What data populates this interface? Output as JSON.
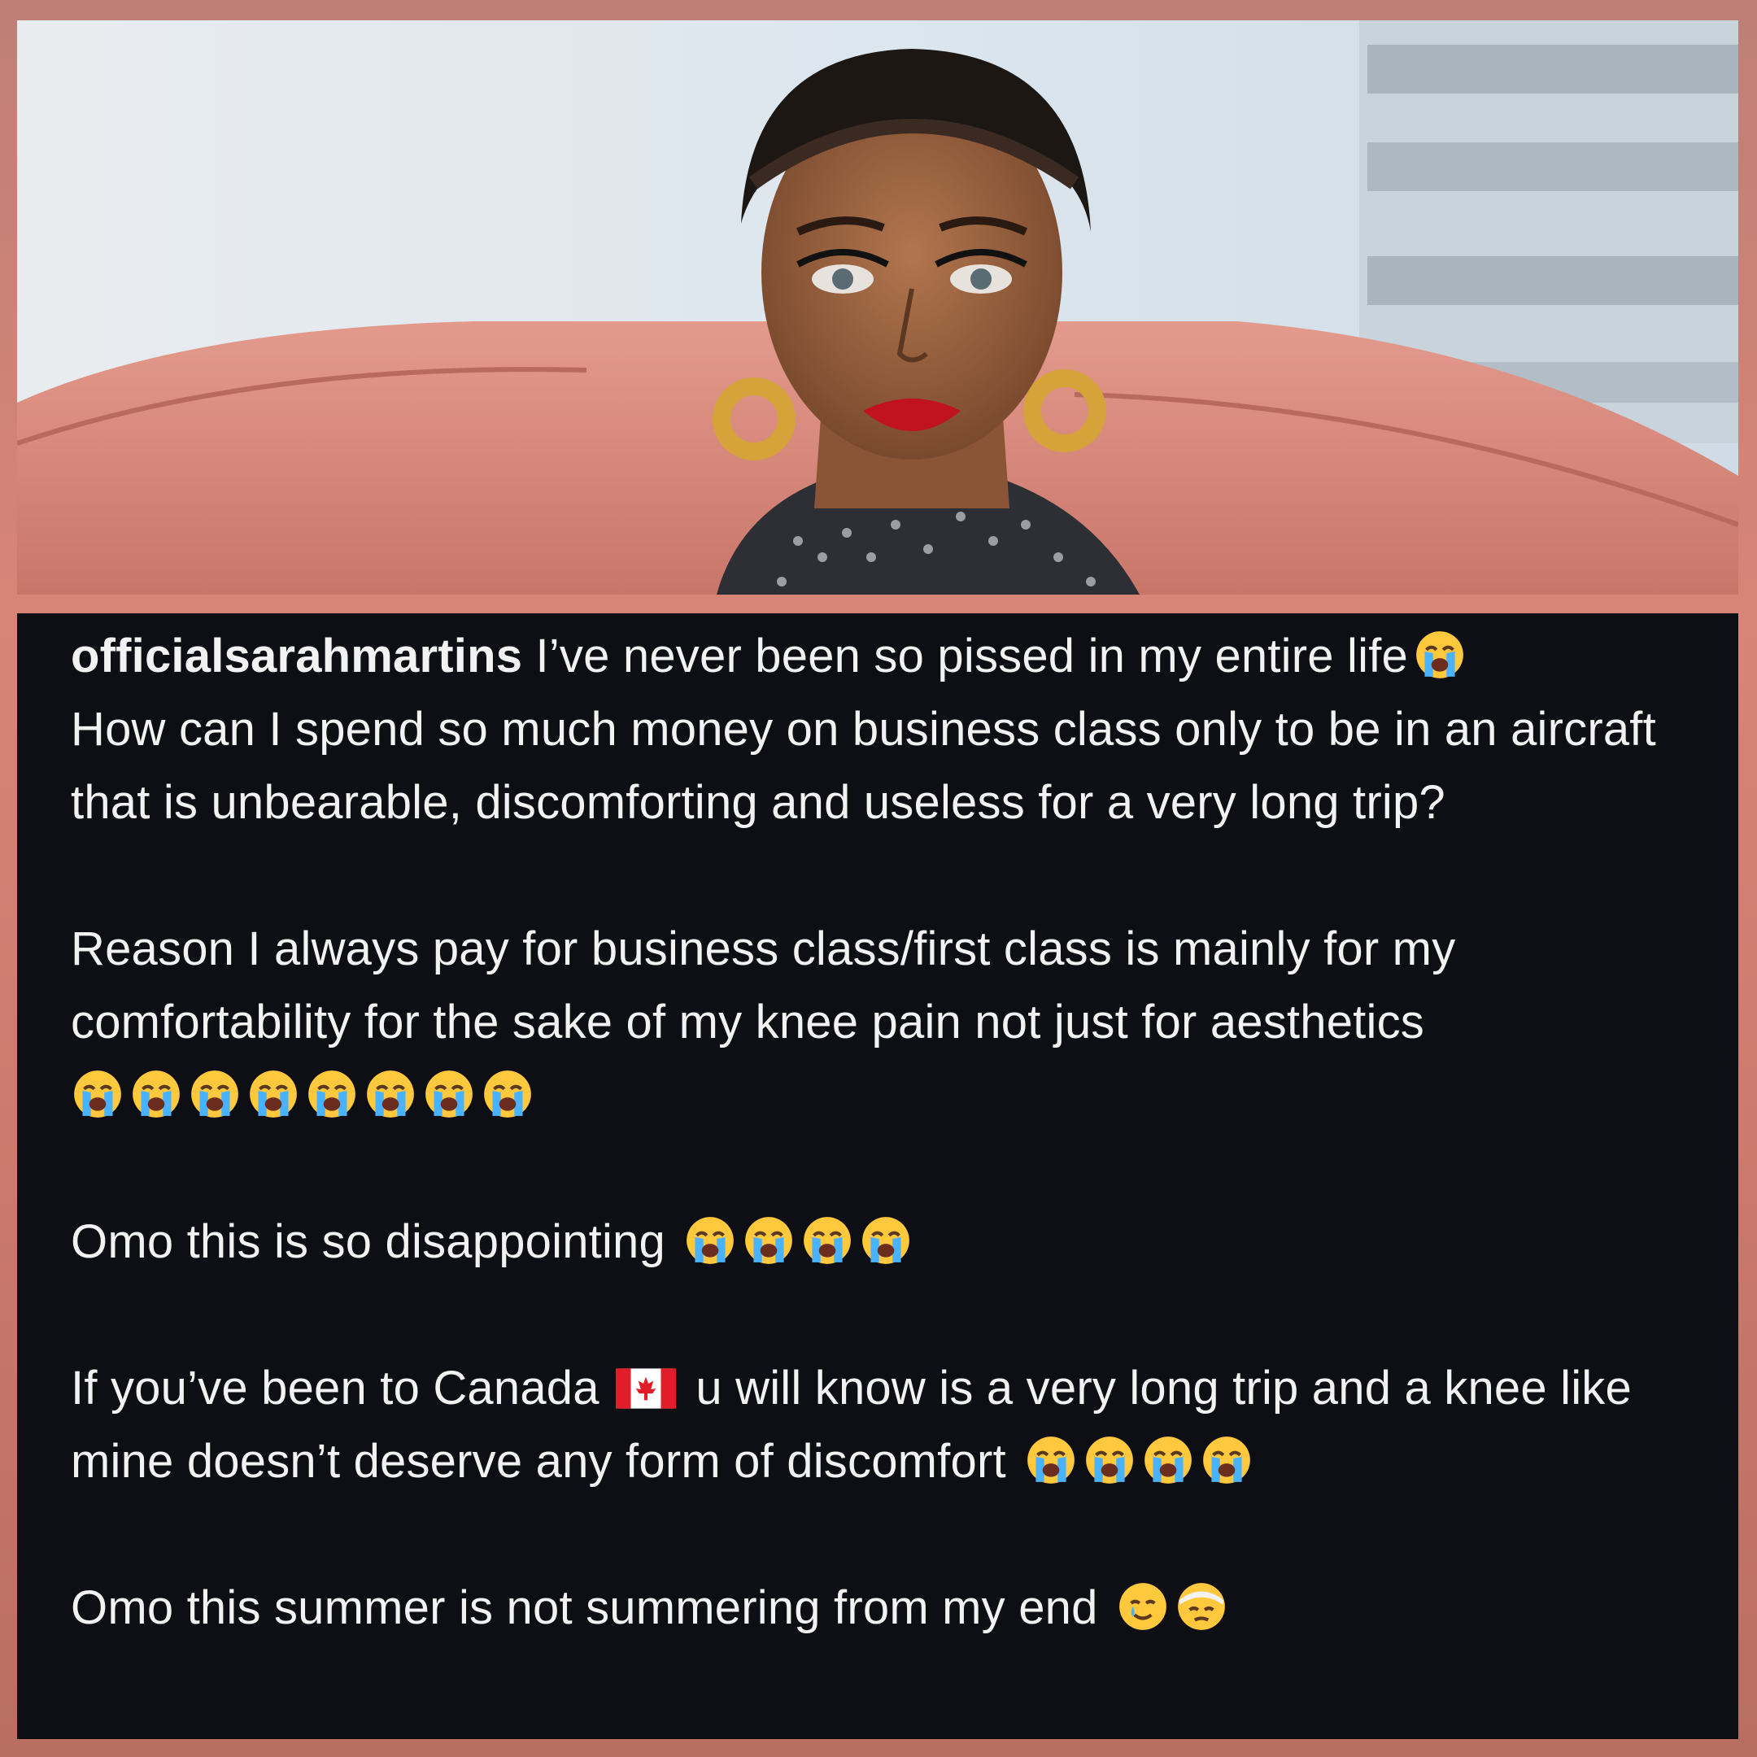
{
  "post": {
    "username": "officialsarahmartins",
    "paragraphs": [
      {
        "text": " I’ve never been so pissed in my entire life",
        "emoji_after": [
          "loudly-crying-face"
        ],
        "continuation": "How can I spend so much money on business class only to be in an aircraft that is unbearable, discomforting and useless for a very long trip?"
      },
      {
        "text": "Reason I always pay for business class/first class is mainly for my comfortability for the sake of my knee pain not just for aesthetics",
        "emoji_after": [
          "loudly-crying-face",
          "loudly-crying-face",
          "loudly-crying-face",
          "loudly-crying-face",
          "loudly-crying-face",
          "loudly-crying-face",
          "loudly-crying-face",
          "loudly-crying-face"
        ]
      },
      {
        "text": "Omo this is so disappointing ",
        "emoji_after": [
          "loudly-crying-face",
          "loudly-crying-face",
          "loudly-crying-face",
          "loudly-crying-face"
        ]
      },
      {
        "text_before_flag": "If you’ve been to Canada ",
        "flag": "canada-flag-icon",
        "text_after_flag": " u will know is a very long trip and a knee like mine doesn’t deserve any form of discomfort ",
        "emoji_after": [
          "loudly-crying-face",
          "loudly-crying-face",
          "loudly-crying-face",
          "loudly-crying-face"
        ]
      },
      {
        "text": "Omo this summer is not summering from my end ",
        "emoji_after": [
          "smiling-face-with-tear",
          "face-with-head-bandage"
        ]
      }
    ]
  },
  "colors": {
    "caption_bg": "#0d0f14",
    "caption_text": "#f2f2f2",
    "frame": "#d88577",
    "sofa": "#d98a7e"
  }
}
